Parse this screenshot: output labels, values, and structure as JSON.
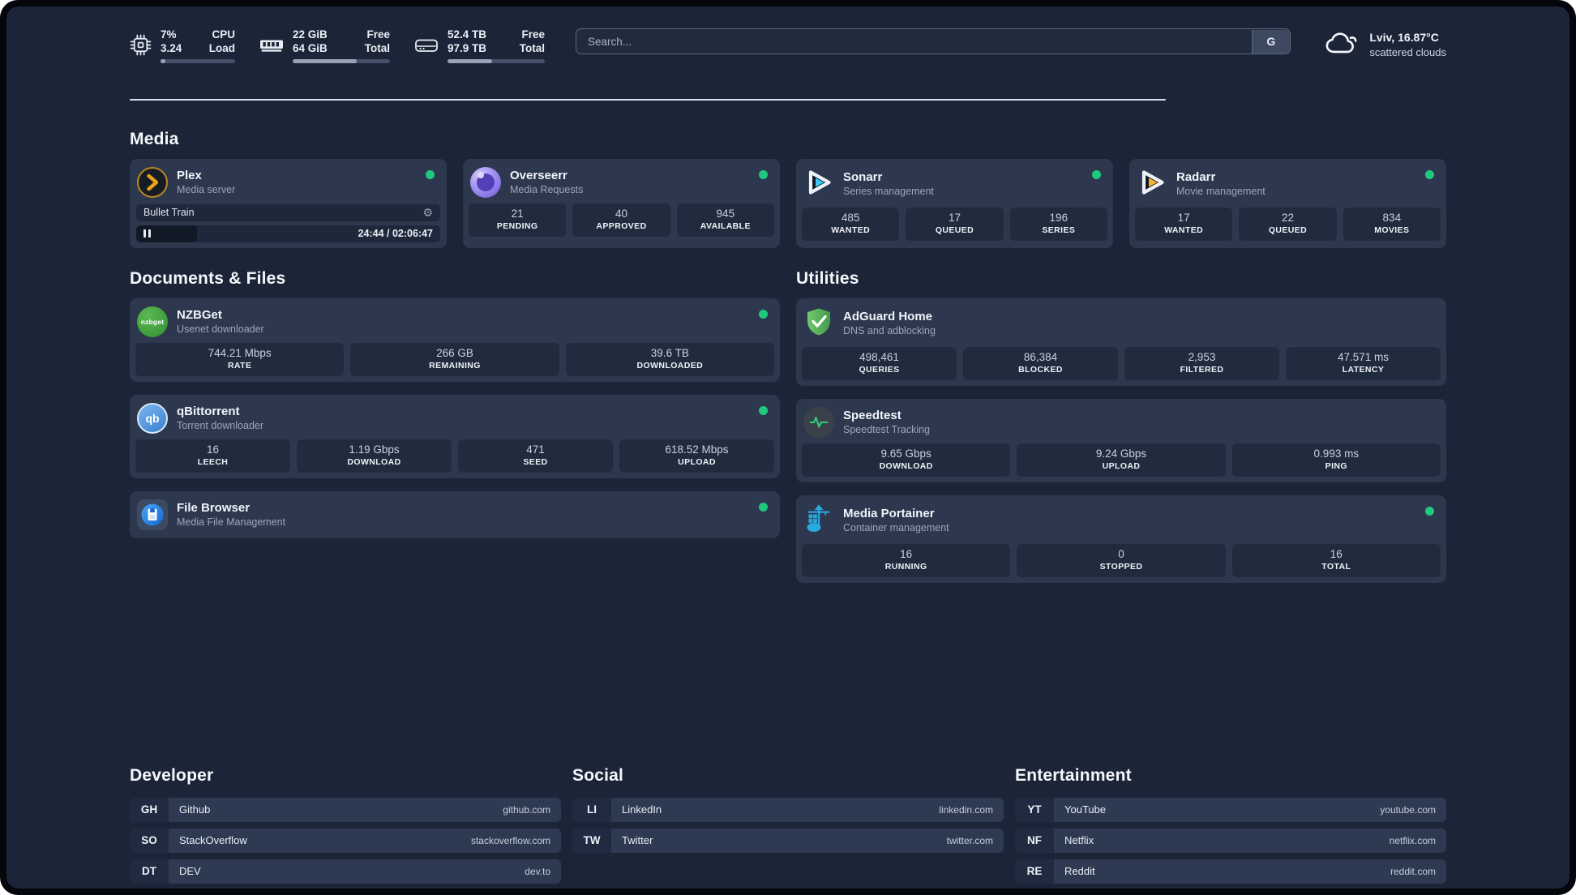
{
  "colors": {
    "status_online": "#1ec97e",
    "page_bg": "#1c2537",
    "card_bg": "#2d384e"
  },
  "header": {
    "cpu": {
      "icon": "cpu-icon",
      "values": [
        "7%",
        "3.24"
      ],
      "labels": [
        "CPU",
        "Load"
      ],
      "usage_pct": 7
    },
    "memory": {
      "icon": "memory-icon",
      "values": [
        "22 GiB",
        "64 GiB"
      ],
      "labels": [
        "Free",
        "Total"
      ],
      "usage_pct": 66
    },
    "disk": {
      "icon": "disk-icon",
      "values": [
        "52.4 TB",
        "97.9 TB"
      ],
      "labels": [
        "Free",
        "Total"
      ],
      "usage_pct": 46
    },
    "search": {
      "placeholder": "Search...",
      "button_label": "G"
    },
    "weather": {
      "icon": "cloud-icon",
      "location": "Lviv, 16.87°C",
      "condition": "scattered clouds"
    }
  },
  "media": {
    "title": "Media",
    "plex": {
      "icon": "plex-icon",
      "name": "Plex",
      "subtitle": "Media server",
      "online": true,
      "now_playing": {
        "title": "Bullet Train",
        "time": "24:44 / 02:06:47",
        "progress_pct": 20
      }
    },
    "overseerr": {
      "icon": "overseerr-icon",
      "name": "Overseerr",
      "subtitle": "Media Requests",
      "online": true,
      "stats": [
        {
          "value": "21",
          "label": "PENDING"
        },
        {
          "value": "40",
          "label": "APPROVED"
        },
        {
          "value": "945",
          "label": "AVAILABLE"
        }
      ]
    },
    "sonarr": {
      "icon": "sonarr-icon",
      "name": "Sonarr",
      "subtitle": "Series management",
      "online": true,
      "stats": [
        {
          "value": "485",
          "label": "WANTED"
        },
        {
          "value": "17",
          "label": "QUEUED"
        },
        {
          "value": "196",
          "label": "SERIES"
        }
      ]
    },
    "radarr": {
      "icon": "radarr-icon",
      "name": "Radarr",
      "subtitle": "Movie management",
      "online": true,
      "stats": [
        {
          "value": "17",
          "label": "WANTED"
        },
        {
          "value": "22",
          "label": "QUEUED"
        },
        {
          "value": "834",
          "label": "MOVIES"
        }
      ]
    }
  },
  "documents": {
    "title": "Documents & Files",
    "nzbget": {
      "icon": "nzbget-icon",
      "icon_text": "nzbget",
      "name": "NZBGet",
      "subtitle": "Usenet downloader",
      "online": true,
      "stats": [
        {
          "value": "744.21 Mbps",
          "label": "RATE"
        },
        {
          "value": "266 GB",
          "label": "REMAINING"
        },
        {
          "value": "39.6 TB",
          "label": "DOWNLOADED"
        }
      ]
    },
    "qbittorrent": {
      "icon": "qbittorrent-icon",
      "icon_text": "qb",
      "name": "qBittorrent",
      "subtitle": "Torrent downloader",
      "online": true,
      "stats": [
        {
          "value": "16",
          "label": "LEECH"
        },
        {
          "value": "1.19 Gbps",
          "label": "DOWNLOAD"
        },
        {
          "value": "471",
          "label": "SEED"
        },
        {
          "value": "618.52 Mbps",
          "label": "UPLOAD"
        }
      ]
    },
    "filebrowser": {
      "icon": "filebrowser-icon",
      "name": "File Browser",
      "subtitle": "Media File Management",
      "online": true
    }
  },
  "utilities": {
    "title": "Utilities",
    "adguard": {
      "icon": "adguard-icon",
      "name": "AdGuard Home",
      "subtitle": "DNS and adblocking",
      "stats": [
        {
          "value": "498,461",
          "label": "QUERIES"
        },
        {
          "value": "86,384",
          "label": "BLOCKED"
        },
        {
          "value": "2,953",
          "label": "FILTERED"
        },
        {
          "value": "47.571 ms",
          "label": "LATENCY"
        }
      ]
    },
    "speedtest": {
      "icon": "speedtest-icon",
      "name": "Speedtest",
      "subtitle": "Speedtest Tracking",
      "stats": [
        {
          "value": "9.65 Gbps",
          "label": "DOWNLOAD"
        },
        {
          "value": "9.24 Gbps",
          "label": "UPLOAD"
        },
        {
          "value": "0.993 ms",
          "label": "PING"
        }
      ]
    },
    "portainer": {
      "icon": "portainer-icon",
      "name": "Media Portainer",
      "subtitle": "Container management",
      "online": true,
      "stats": [
        {
          "value": "16",
          "label": "RUNNING"
        },
        {
          "value": "0",
          "label": "STOPPED"
        },
        {
          "value": "16",
          "label": "TOTAL"
        }
      ]
    }
  },
  "links": {
    "developer": {
      "title": "Developer",
      "items": [
        {
          "abbr": "GH",
          "name": "Github",
          "url": "github.com"
        },
        {
          "abbr": "SO",
          "name": "StackOverflow",
          "url": "stackoverflow.com"
        },
        {
          "abbr": "DT",
          "name": "DEV",
          "url": "dev.to"
        }
      ]
    },
    "social": {
      "title": "Social",
      "items": [
        {
          "abbr": "LI",
          "name": "LinkedIn",
          "url": "linkedin.com"
        },
        {
          "abbr": "TW",
          "name": "Twitter",
          "url": "twitter.com"
        }
      ]
    },
    "entertainment": {
      "title": "Entertainment",
      "items": [
        {
          "abbr": "YT",
          "name": "YouTube",
          "url": "youtube.com"
        },
        {
          "abbr": "NF",
          "name": "Netflix",
          "url": "netflix.com"
        },
        {
          "abbr": "RE",
          "name": "Reddit",
          "url": "reddit.com"
        }
      ]
    }
  }
}
